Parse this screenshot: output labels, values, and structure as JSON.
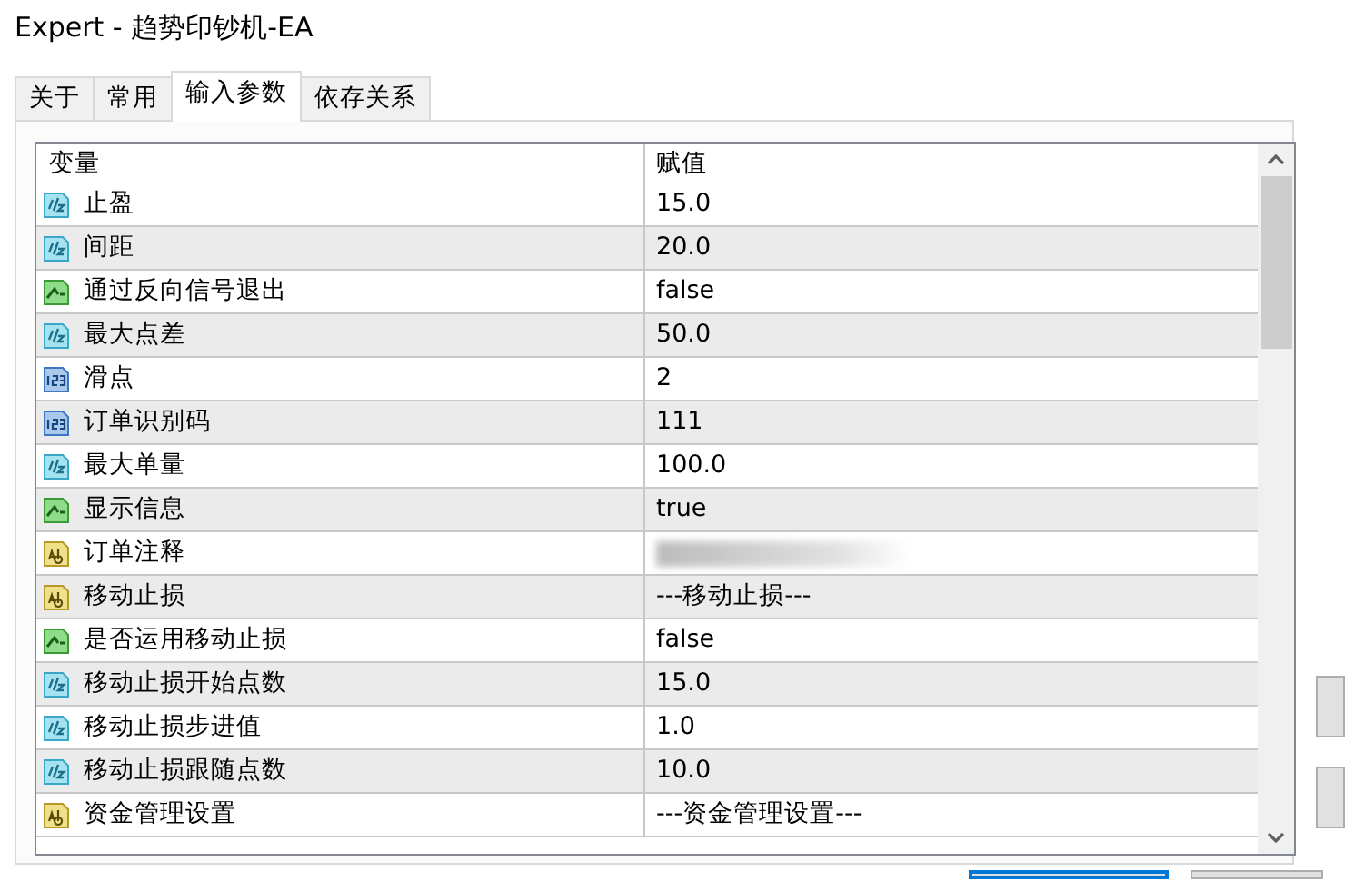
{
  "window": {
    "title": "Expert - 趋势印钞机-EA"
  },
  "tabs": [
    {
      "label": "关于",
      "selected": false
    },
    {
      "label": "常用",
      "selected": false
    },
    {
      "label": "输入参数",
      "selected": true
    },
    {
      "label": "依存关系",
      "selected": false
    }
  ],
  "table": {
    "columns": [
      "变量",
      "赋值"
    ],
    "rows": [
      {
        "kind": "double",
        "name": "止盈",
        "value": "15.0"
      },
      {
        "kind": "double",
        "name": "间距",
        "value": "20.0"
      },
      {
        "kind": "bool",
        "name": "通过反向信号退出",
        "value": "false"
      },
      {
        "kind": "double",
        "name": "最大点差",
        "value": "50.0"
      },
      {
        "kind": "int",
        "name": "滑点",
        "value": "2"
      },
      {
        "kind": "int",
        "name": "订单识别码",
        "value": "111"
      },
      {
        "kind": "double",
        "name": "最大单量",
        "value": "100.0"
      },
      {
        "kind": "bool",
        "name": "显示信息",
        "value": "true"
      },
      {
        "kind": "string",
        "name": "订单注释",
        "blurred": true
      },
      {
        "kind": "string",
        "name": "移动止损",
        "value": "---移动止损---"
      },
      {
        "kind": "bool",
        "name": "是否运用移动止损",
        "value": "false"
      },
      {
        "kind": "double",
        "name": "移动止损开始点数",
        "value": "15.0"
      },
      {
        "kind": "double",
        "name": "移动止损步进值",
        "value": "1.0"
      },
      {
        "kind": "double",
        "name": "移动止损跟随点数",
        "value": "10.0"
      },
      {
        "kind": "string",
        "name": "资金管理设置",
        "value": "---资金管理设置---"
      }
    ]
  }
}
